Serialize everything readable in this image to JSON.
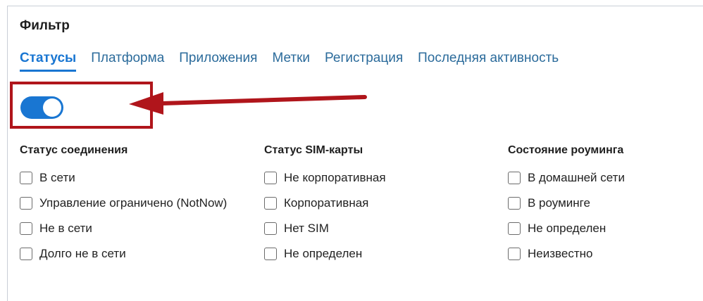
{
  "filter": {
    "title": "Фильтр",
    "tabs": [
      {
        "label": "Статусы"
      },
      {
        "label": "Платформа"
      },
      {
        "label": "Приложения"
      },
      {
        "label": "Метки"
      },
      {
        "label": "Регистрация"
      },
      {
        "label": "Последняя активность"
      }
    ],
    "toggle": {
      "state": "on"
    },
    "columns": [
      {
        "heading": "Статус соединения",
        "items": [
          "В сети",
          "Управление ограничено (NotNow)",
          "Не в сети",
          "Долго не в сети"
        ]
      },
      {
        "heading": "Статус SIM-карты",
        "items": [
          "Не корпоративная",
          "Корпоративная",
          "Нет SIM",
          "Не определен"
        ]
      },
      {
        "heading": "Состояние роуминга",
        "items": [
          "В домашней сети",
          "В роуминге",
          "Не определен",
          "Неизвестно"
        ]
      }
    ]
  },
  "colors": {
    "accent": "#1976d2",
    "annotation": "#b0151b"
  }
}
